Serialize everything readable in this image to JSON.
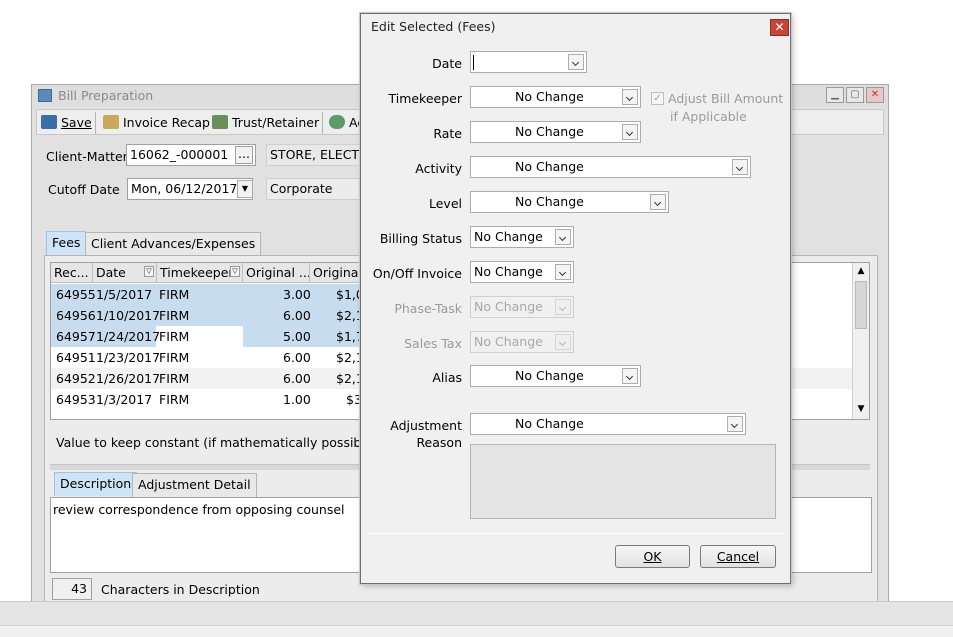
{
  "bill_window": {
    "title": "Bill Preparation",
    "toolbar": {
      "save": "Save",
      "invoice_recap": "Invoice Recap",
      "trust_retainer": "Trust/Retainer",
      "truncated": "Ac"
    },
    "client_matter_label": "Client-Matter",
    "client_matter_value": "16062_-000001",
    "client_matter_ellipsis": "...",
    "client_name": "STORE, ELECTR",
    "cutoff_label": "Cutoff Date",
    "cutoff_value": "Mon, 06/12/2017",
    "type_value": "Corporate",
    "tabs": [
      "Fees",
      "Client Advances/Expenses"
    ],
    "grid": {
      "headers": [
        "Rec...",
        "Date",
        "Timekeeper",
        "Original ...",
        "Original"
      ],
      "rows": [
        {
          "rec": "64955",
          "date": "1/5/2017",
          "tk": "FIRM",
          "hours": "3.00",
          "amt": "$1,0"
        },
        {
          "rec": "64956",
          "date": "1/10/2017",
          "tk": "FIRM",
          "hours": "6.00",
          "amt": "$2,1"
        },
        {
          "rec": "64957",
          "date": "1/24/2017",
          "tk": "FIRM",
          "hours": "5.00",
          "amt": "$1,7"
        },
        {
          "rec": "64951",
          "date": "1/23/2017",
          "tk": "FIRM",
          "hours": "6.00",
          "amt": "$2,1"
        },
        {
          "rec": "64952",
          "date": "1/26/2017",
          "tk": "FIRM",
          "hours": "6.00",
          "amt": "$2,1"
        },
        {
          "rec": "64953",
          "date": "1/3/2017",
          "tk": "FIRM",
          "hours": "1.00",
          "amt": "$3"
        }
      ]
    },
    "value_constant_text": "Value to keep constant (if mathematically possible)",
    "desc_tabs": [
      "Description",
      "Adjustment Detail"
    ],
    "description_text": "review correspondence from opposing counsel",
    "char_count": "43",
    "char_count_label": "Characters in Description"
  },
  "dialog": {
    "title": "Edit Selected (Fees)",
    "close_glyph": "✕",
    "fields": {
      "date_label": "Date",
      "date_value": "",
      "timekeeper_label": "Timekeeper",
      "timekeeper_value": "No Change",
      "adjust_line1": "Adjust Bill Amount",
      "adjust_line2": "if Applicable",
      "rate_label": "Rate",
      "rate_value": "No Change",
      "activity_label": "Activity",
      "activity_value": "No Change",
      "level_label": "Level",
      "level_value": "No Change",
      "billing_status_label": "Billing Status",
      "billing_status_value": "No Change",
      "onoff_label": "On/Off Invoice",
      "onoff_value": "No Change",
      "phase_label": "Phase-Task",
      "phase_value": "No Change",
      "sales_tax_label": "Sales Tax",
      "sales_tax_value": "No Change",
      "alias_label": "Alias",
      "alias_value": "No Change",
      "adj_reason_label_1": "Adjustment",
      "adj_reason_label_2": "Reason",
      "adj_reason_value": "No Change"
    },
    "ok_label": "OK",
    "cancel_label": "Cancel"
  },
  "colors": {
    "selection": "#c7dcee",
    "close_red": "#c7463a",
    "active_tab": "#cfe4f7"
  }
}
